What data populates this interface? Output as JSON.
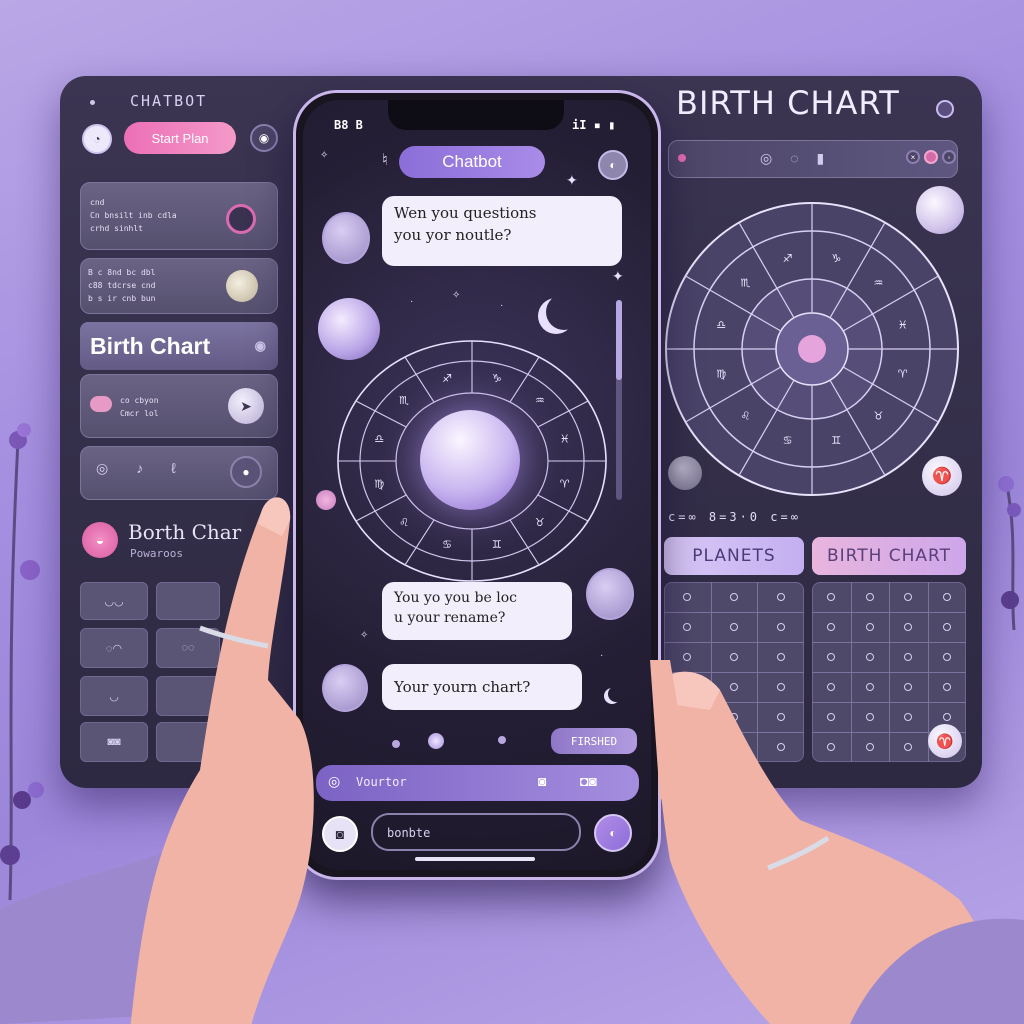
{
  "dashboard": {
    "left_title": "CHATBOT",
    "right_title": "BIRTH CHART",
    "top_pill": "Start Plan",
    "card1_lines": [
      "cnd",
      "Cn bnsilt inb cdla",
      "crhd sinhlt"
    ],
    "card2_lines": [
      "B c 8nd bc dbl",
      "c88 tdcrse cnd",
      "b s ir cnb bun"
    ],
    "birth_tab": "Birth Chart",
    "card3_lines": [
      "co cbyon",
      "Cmcr lol"
    ],
    "avatar_title": "Borth Char",
    "avatar_sub": "Powaroos",
    "chip_row_text": "c=∞  8=3·0  c=∞",
    "planets_label": "PLANETS",
    "birth_chart_label": "BIRTH CHART"
  },
  "phone": {
    "status_left": "B8 B",
    "status_right": "iI ▪ ▮",
    "chatbot_label": "Chatbot",
    "bubble1": [
      "Wen you questions",
      "you yor noutle?"
    ],
    "bubble2": [
      "You yo you be loc",
      "u your rename?"
    ],
    "bubble3": "Your yourn chart?",
    "reply_button": "FIRSHED",
    "input_placeholder": "Vourtor",
    "bottom_placeholder": "bonbte"
  },
  "colors": {
    "accent": "#8b6ed8",
    "pink": "#e56bb2",
    "panel": "#2e2942"
  }
}
